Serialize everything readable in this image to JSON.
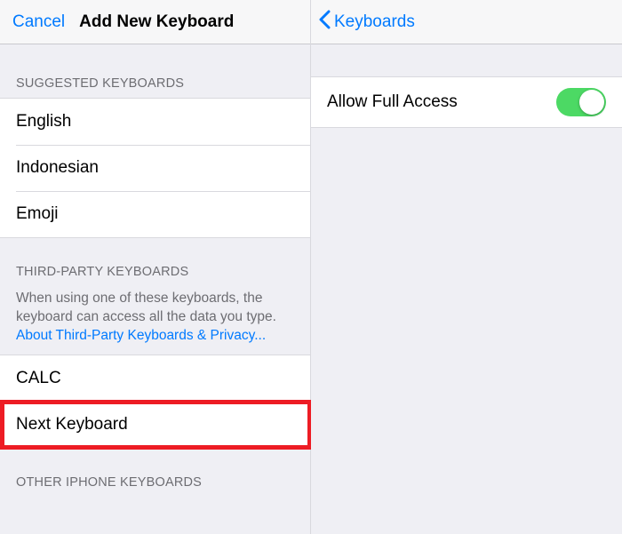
{
  "left": {
    "nav": {
      "cancel": "Cancel",
      "title": "Add New Keyboard"
    },
    "suggested_header": "SUGGESTED KEYBOARDS",
    "suggested": [
      {
        "label": "English"
      },
      {
        "label": "Indonesian"
      },
      {
        "label": "Emoji"
      }
    ],
    "thirdparty_header": "THIRD-PARTY KEYBOARDS",
    "thirdparty_desc_pre": "When using one of these keyboards, the keyboard can access all the data you type. ",
    "thirdparty_link": "About Third-Party Keyboards & Privacy...",
    "thirdparty": [
      {
        "label": "CALC"
      },
      {
        "label": "Next Keyboard",
        "highlighted": true
      }
    ],
    "other_header": "OTHER IPHONE KEYBOARDS"
  },
  "right": {
    "nav": {
      "back": "Keyboards"
    },
    "allow_full_access_label": "Allow Full Access",
    "allow_full_access_on": true
  }
}
